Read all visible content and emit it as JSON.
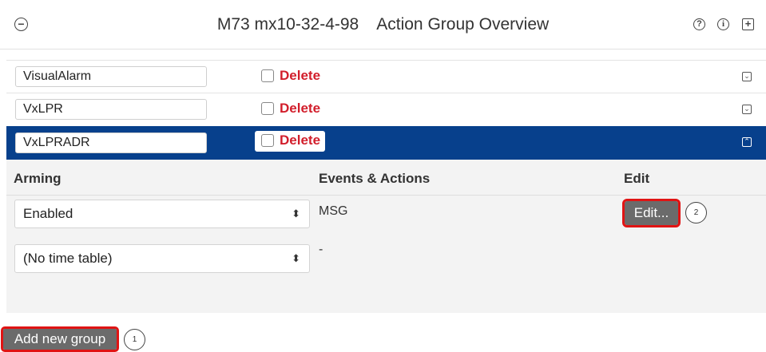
{
  "header": {
    "device": "M73 mx10-32-4-98",
    "title": "Action Group Overview",
    "collapse_icon": "minus-circle-icon",
    "help_icon": "question-circle-icon",
    "info_icon": "info-circle-icon",
    "expand_icon": "plus-square-icon",
    "help_glyph": "?",
    "info_glyph": "i",
    "expand_glyph": "+",
    "collapse_glyph": "−"
  },
  "groups": [
    {
      "name": "VisualAlarm",
      "delete_label": "Delete",
      "selected": false
    },
    {
      "name": "VxLPR",
      "delete_label": "Delete",
      "selected": false
    },
    {
      "name": "VxLPRADR",
      "delete_label": "Delete",
      "selected": true
    }
  ],
  "detail": {
    "headers": {
      "arming": "Arming",
      "events": "Events & Actions",
      "edit": "Edit"
    },
    "arming_select": "Enabled",
    "timetable_select": "(No time table)",
    "event_value": "MSG",
    "event_value2": "-",
    "edit_button": "Edit...",
    "edit_callout": "2"
  },
  "footer": {
    "add_button": "Add new group",
    "add_callout": "1"
  },
  "colors": {
    "selected_row": "#07408c",
    "delete_text": "#d21e2b",
    "highlight": "#e01414",
    "button": "#6b6b6b"
  }
}
